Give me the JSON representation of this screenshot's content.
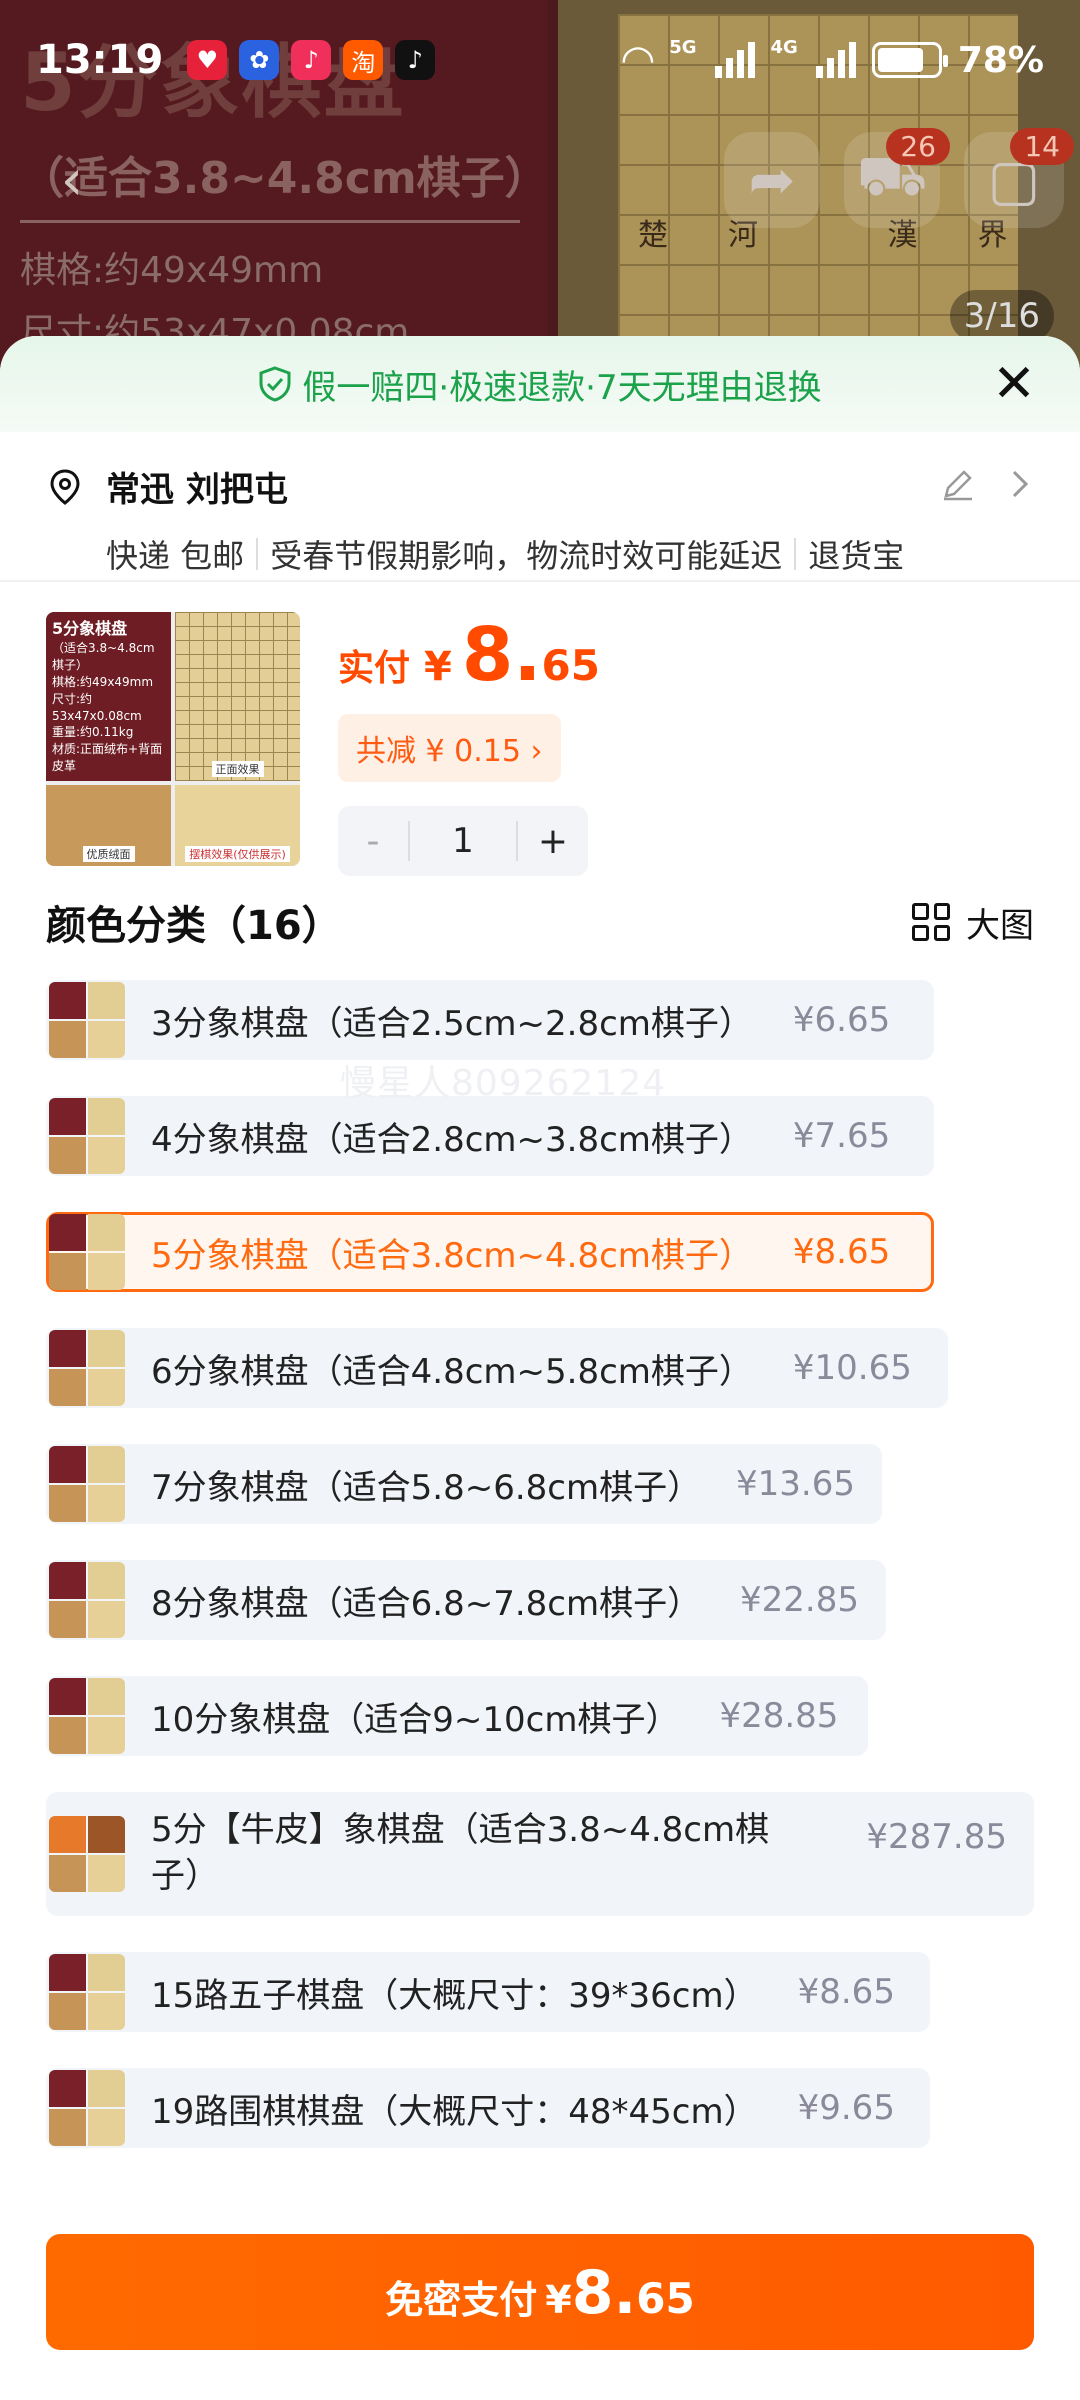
{
  "status_bar": {
    "time": "13:19",
    "network1": "5G",
    "network2": "4G",
    "battery": "78%"
  },
  "background": {
    "title": "5分象棋盘",
    "subtitle": "（适合3.8~4.8cm棋子）",
    "spec1": "棋格:约49x49mm",
    "spec2": "尺寸:约53x47x0.08cm",
    "river_text": "楚河 漢界",
    "page_indicator": "3/16",
    "cart_badge": "26",
    "msg_badge": "14"
  },
  "sheet": {
    "guarantee": "假一赔四·极速退款·7天无理由退换",
    "address": {
      "name": "常迅 刘把屯",
      "shipping": "快递 包邮",
      "notice": "受春节假期影响，物流时效可能延迟",
      "service": "退货宝"
    },
    "product": {
      "paid_label": "实付",
      "currency": "¥",
      "price_int": "8.",
      "price_dec": "65",
      "reduce": "共减 ¥ 0.15 ›",
      "quantity": "1",
      "minus": "-",
      "plus": "+",
      "thumb": {
        "title": "5分象棋盘",
        "sub": "（适合3.8~4.8cm棋子）",
        "spec1": "棋格:约49x49mm",
        "spec2": "尺寸:约53x47x0.08cm",
        "spec3": "重量:约0.11kg",
        "spec4": "材质:正面绒布+背面皮革",
        "caption1": "正面效果",
        "caption2": "优质绒面",
        "caption3": "摆棋效果(仅供展示)"
      }
    },
    "category_title": "颜色分类（16）",
    "big_image_label": "大图",
    "watermark": "慢星人809262124",
    "options": [
      {
        "name": "3分象棋盘（适合2.5cm~2.8cm棋子）",
        "price": "¥6.65"
      },
      {
        "name": "4分象棋盘（适合2.8cm~3.8cm棋子）",
        "price": "¥7.65"
      },
      {
        "name": "5分象棋盘（适合3.8cm~4.8cm棋子）",
        "price": "¥8.65",
        "selected": true
      },
      {
        "name": "6分象棋盘（适合4.8cm~5.8cm棋子）",
        "price": "¥10.65"
      },
      {
        "name": "7分象棋盘（适合5.8~6.8cm棋子）",
        "price": "¥13.65"
      },
      {
        "name": "8分象棋盘（适合6.8~7.8cm棋子）",
        "price": "¥22.85"
      },
      {
        "name": "10分象棋盘（适合9~10cm棋子）",
        "price": "¥28.85"
      },
      {
        "name": "5分【牛皮】象棋盘（适合3.8~4.8cm棋子）",
        "price": "¥287.85"
      },
      {
        "name": "15路五子棋盘（大概尺寸：39*36cm）",
        "price": "¥8.65"
      },
      {
        "name": "19路围棋棋盘（大概尺寸：48*45cm）",
        "price": "¥9.65"
      }
    ],
    "pay_button": {
      "label": "免密支付",
      "currency": "¥",
      "int": "8.",
      "dec": "65"
    }
  },
  "colors": {
    "accent": "#ff6a00",
    "guarantee_green": "#1ba24b",
    "selected_border": "#ff6a10"
  }
}
